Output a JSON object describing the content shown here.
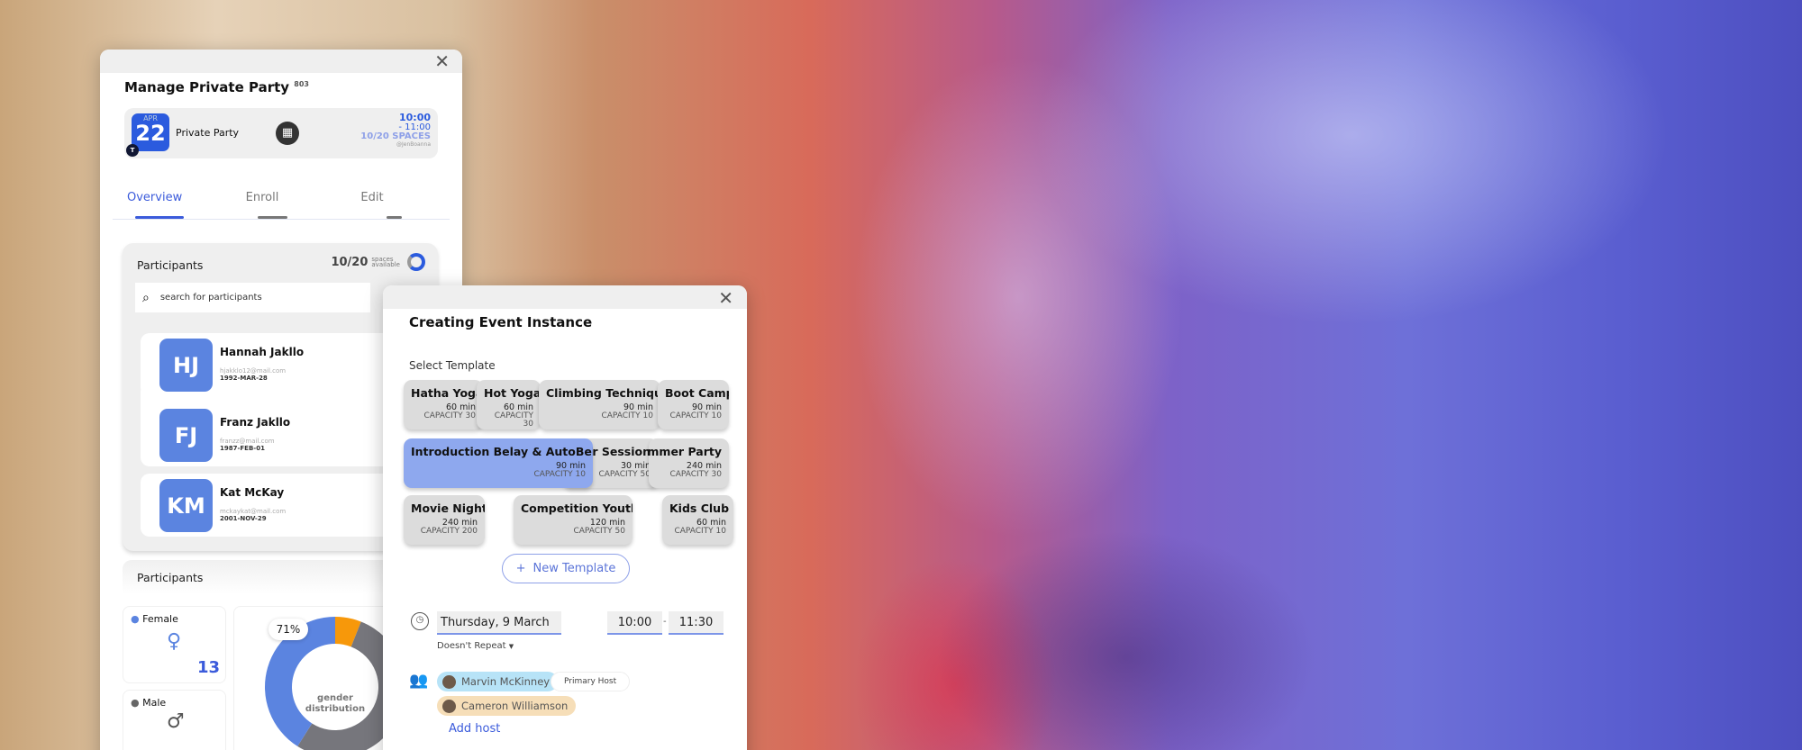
{
  "manage_panel": {
    "title": "Manage Private Party",
    "title_id": "803",
    "event": {
      "month": "APR",
      "day": "22",
      "badge": "T",
      "name": "Private Party",
      "icon": "calendar-grid-icon",
      "start": "10:00",
      "end": "- 11:00",
      "spaces": "10/20 SPACES",
      "host": "@JenBoanna"
    },
    "tabs": [
      {
        "label": "Overview",
        "active": true
      },
      {
        "label": "Enroll"
      },
      {
        "label": "Edit"
      }
    ],
    "participants": {
      "title": "Participants",
      "count": "10/20",
      "spaces_label_1": "spaces",
      "spaces_label_2": "available",
      "fill_fraction": 0.5,
      "search_placeholder": "search for participants",
      "list": [
        {
          "initials": "HJ",
          "name": "Hannah Jakllo",
          "email": "hjakklo12@mail.com",
          "dob": "1992-MAR-28"
        },
        {
          "initials": "FJ",
          "name": "Franz Jakllo",
          "email": "franzz@mail.com",
          "dob": "1987-FEB-01"
        },
        {
          "initials": "KM",
          "name": "Kat McKay",
          "email": "mckaykat@mail.com",
          "dob": "2001-NOV-29"
        }
      ]
    },
    "stats": {
      "title": "Participants",
      "female_label": "Female",
      "female_count": "13",
      "male_label": "Male",
      "donut_label_1": "gender",
      "donut_label_2": "distribution",
      "donut_percent": "71%",
      "segments": [
        {
          "color": "#f7980a",
          "fraction": 0.06
        },
        {
          "color": "#76767c",
          "fraction": 0.53
        },
        {
          "color": "#5b84e0",
          "fraction": 0.41
        }
      ]
    }
  },
  "event_panel": {
    "title": "Creating Event Instance",
    "select_label": "Select Template",
    "templates": [
      {
        "name": "Hatha Yoga",
        "duration": "60 min",
        "capacity": "CAPACITY 30"
      },
      {
        "name": "Hot Yoga",
        "duration": "60 min",
        "capacity": "CAPACITY 30"
      },
      {
        "name": "Climbing Technique",
        "duration": "90 min",
        "capacity": "CAPACITY 10"
      },
      {
        "name": "Boot Camp",
        "duration": "90 min",
        "capacity": "CAPACITY 10"
      },
      {
        "name": "Taster Session",
        "duration": "30 min",
        "capacity": "CAPACITY 50"
      },
      {
        "name": "Summer Party",
        "duration": "240 min",
        "capacity": "CAPACITY 30"
      },
      {
        "name": "Introduction Belay & AutoBelay",
        "duration": "90 min",
        "capacity": "CAPACITY 10",
        "selected": true
      },
      {
        "name": "Movie Night",
        "duration": "240 min",
        "capacity": "CAPACITY 200"
      },
      {
        "name": "Competition Youth",
        "duration": "120 min",
        "capacity": "CAPACITY 50"
      },
      {
        "name": "Kids Club",
        "duration": "60 min",
        "capacity": "CAPACITY 10"
      }
    ],
    "new_template": "New Template",
    "date": "Thursday, 9 March",
    "start": "10:00",
    "end": "11:30",
    "sep": "-",
    "repeat": "Doesn't Repeat",
    "hosts": [
      {
        "name": "Marvin McKinney",
        "color": "#b7e3f7"
      },
      {
        "name": "Cameron Williamson",
        "color": "#f6deb8"
      }
    ],
    "primary_host": "Primary Host",
    "add_host": "Add host"
  },
  "colors": {
    "accent": "#3b5bdb",
    "avatar": "#5b84e0",
    "selected_template": "#8ea8ee"
  }
}
